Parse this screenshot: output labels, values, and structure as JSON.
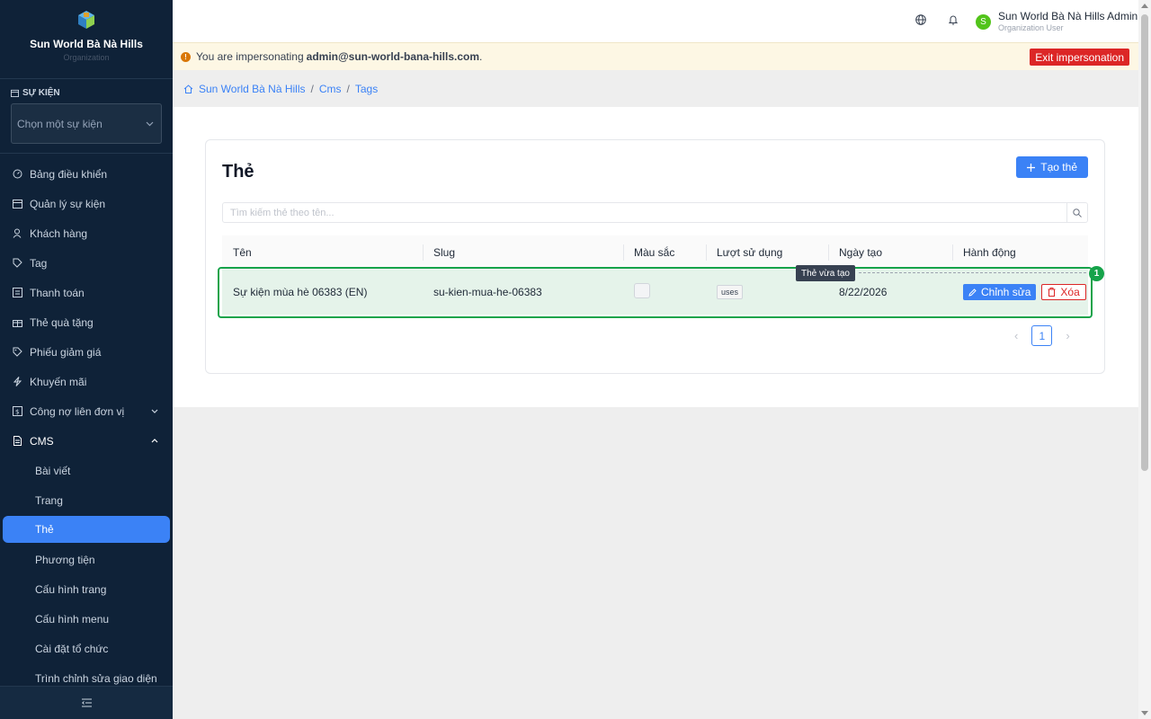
{
  "sidebar": {
    "brand_name": "Sun World Bà Nà Hills",
    "brand_sub": "Organization",
    "event_label": "SỰ KIỆN",
    "event_select": "Chọn một sự kiện",
    "items": [
      {
        "label": "Bảng điều khiển",
        "icon": "dashboard-icon"
      },
      {
        "label": "Quản lý sự kiện",
        "icon": "calendar-icon"
      },
      {
        "label": "Khách hàng",
        "icon": "users-icon"
      },
      {
        "label": "Tag",
        "icon": "tag-icon"
      },
      {
        "label": "Thanh toán",
        "icon": "payment-icon"
      },
      {
        "label": "Thẻ quà tặng",
        "icon": "gift-icon"
      },
      {
        "label": "Phiếu giảm giá",
        "icon": "coupon-icon"
      },
      {
        "label": "Khuyến mãi",
        "icon": "promo-icon"
      },
      {
        "label": "Công nợ liên đơn vị",
        "icon": "debt-icon"
      },
      {
        "label": "CMS",
        "icon": "document-icon"
      }
    ],
    "cms_sub": [
      {
        "label": "Bài viết"
      },
      {
        "label": "Trang"
      },
      {
        "label": "Thẻ"
      },
      {
        "label": "Phương tiện"
      },
      {
        "label": "Cấu hình trang"
      },
      {
        "label": "Cấu hình menu"
      },
      {
        "label": "Cài đặt tổ chức"
      },
      {
        "label": "Trình chỉnh sửa giao diện"
      }
    ]
  },
  "header": {
    "user_initial": "S",
    "user_name": "Sun World Bà Nà Hills Admin",
    "user_role": "Organization User"
  },
  "banner": {
    "text": "You are impersonating",
    "email": "admin@sun-world-bana-hills.com",
    "period": ".",
    "exit_label": "Exit impersonation"
  },
  "breadcrumb": [
    "Sun World Bà Nà Hills",
    "Cms",
    "Tags"
  ],
  "page": {
    "title": "Thẻ",
    "create_label": "Tạo thẻ",
    "search_placeholder": "Tìm kiếm thẻ theo tên..."
  },
  "table": {
    "columns": [
      "Tên",
      "Slug",
      "Màu sắc",
      "Lượt sử dụng",
      "Ngày tạo",
      "Hành động"
    ],
    "rows": [
      {
        "name": "Sự kiện mùa hè 06383 (EN)",
        "slug": "su-kien-mua-he-06383",
        "usage": "uses",
        "created": "8/22/2026",
        "edit": "Chỉnh sửa",
        "delete": "Xóa"
      }
    ]
  },
  "highlight": {
    "badge": "1",
    "tooltip": "Thẻ vừa tạo"
  },
  "pagination": {
    "current": "1"
  },
  "colors": {
    "sidebar_bg": "#0f2238",
    "accent": "#3b82f6",
    "danger": "#dc2626",
    "highlight": "#16a34a"
  }
}
